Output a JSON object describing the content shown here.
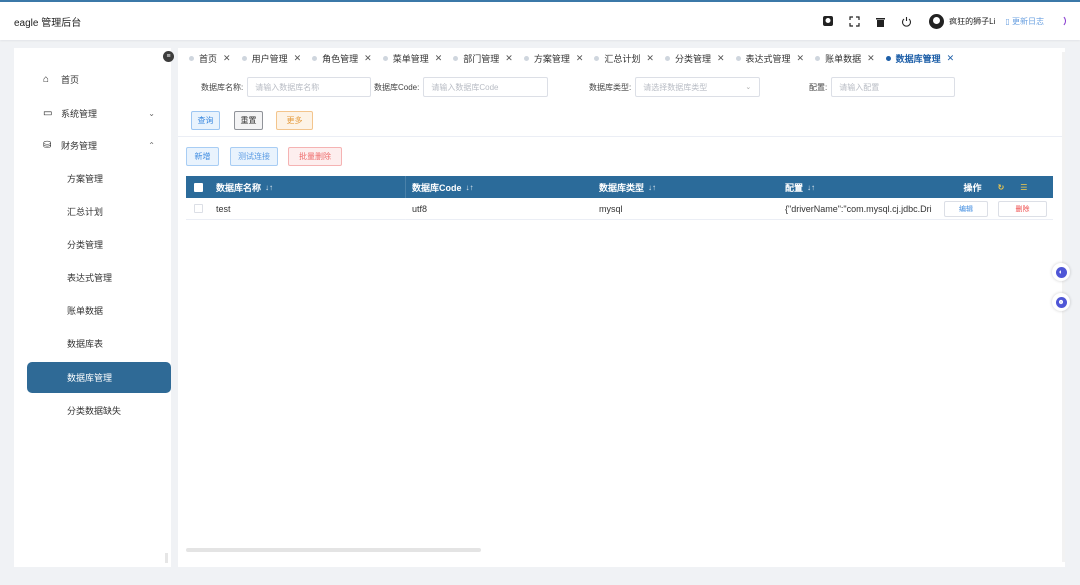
{
  "header": {
    "app_title": "eagle 管理后台",
    "user_name": "疯狂的狮子Li",
    "changelog": "更新日志",
    "icons": [
      "github-icon",
      "fullscreen-icon",
      "trash-icon",
      "power-icon"
    ]
  },
  "sidebar": {
    "home": "首页",
    "system": "系统管理",
    "finance": "财务管理",
    "sub_items": [
      "方案管理",
      "汇总计划",
      "分类管理",
      "表达式管理",
      "账单数据",
      "数据库表",
      "数据库管理",
      "分类数据缺失"
    ],
    "active_index": 6
  },
  "tabs": [
    {
      "label": "首页",
      "active": false
    },
    {
      "label": "用户管理",
      "active": false
    },
    {
      "label": "角色管理",
      "active": false
    },
    {
      "label": "菜单管理",
      "active": false
    },
    {
      "label": "部门管理",
      "active": false
    },
    {
      "label": "方案管理",
      "active": false
    },
    {
      "label": "汇总计划",
      "active": false
    },
    {
      "label": "分类管理",
      "active": false
    },
    {
      "label": "表达式管理",
      "active": false
    },
    {
      "label": "账单数据",
      "active": false
    },
    {
      "label": "数据库管理",
      "active": true
    }
  ],
  "search": {
    "name_label": "数据库名称:",
    "name_placeholder": "请输入数据库名称",
    "code_label": "数据库Code:",
    "code_placeholder": "请输入数据库Code",
    "type_label": "数据库类型:",
    "type_placeholder": "请选择数据库类型",
    "config_label": "配置:",
    "config_placeholder": "请输入配置"
  },
  "buttons": {
    "query": "查询",
    "reset": "重置",
    "more": "更多",
    "add": "新增",
    "test_connection": "测试连接",
    "batch_delete": "批量删除"
  },
  "table": {
    "columns": {
      "name": "数据库名称",
      "code": "数据库Code",
      "type": "数据库类型",
      "config": "配置",
      "ops": "操作"
    },
    "sort_symbol": "↓↑",
    "rows": [
      {
        "name": "test",
        "code": "utf8",
        "type": "mysql",
        "config": "{\"driverName\":\"com.mysql.cj.jdbc.Dri",
        "edit": "编辑",
        "delete": "删除"
      }
    ]
  }
}
